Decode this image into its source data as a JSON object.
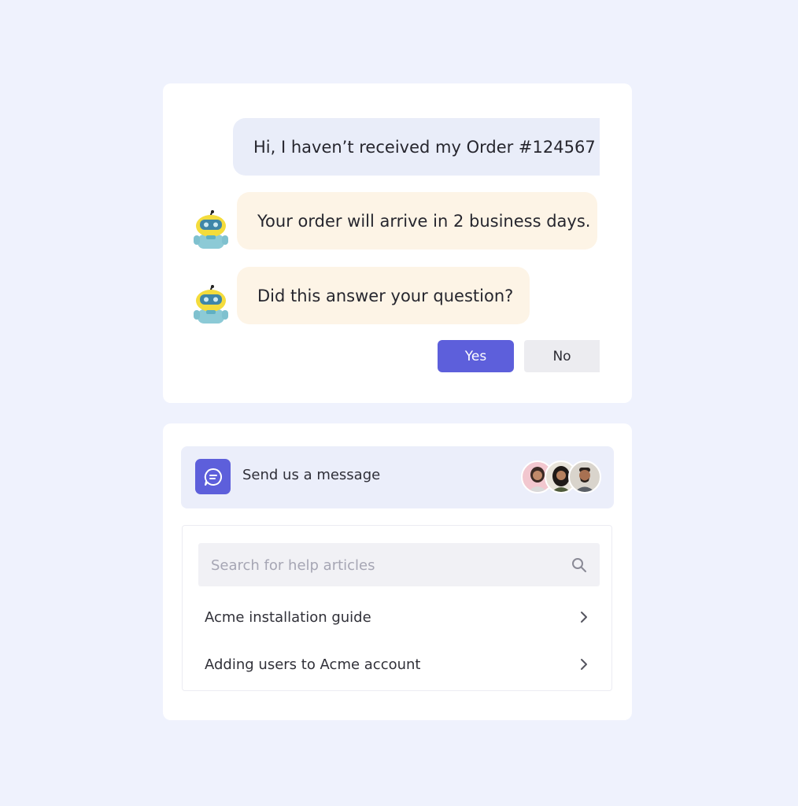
{
  "chat": {
    "messages": [
      {
        "sender": "user",
        "text": "Hi, I haven’t received my Order #124567"
      },
      {
        "sender": "bot",
        "text": "Your order will arrive in 2 business days."
      },
      {
        "sender": "bot",
        "text": "Did this answer your question?"
      }
    ],
    "yes_label": "Yes",
    "no_label": "No"
  },
  "help": {
    "send_label": "Send us a message",
    "search_placeholder": "Search for help articles",
    "articles": [
      {
        "label": "Acme installation guide"
      },
      {
        "label": "Adding users to Acme account"
      }
    ]
  },
  "icons": {
    "send": "chat-bubble-icon",
    "search": "search-icon",
    "article": "chevron-right-icon",
    "bot": "robot-avatar-icon"
  },
  "colors": {
    "accent": "#5d5fdb",
    "user_bubble": "#e9edf9",
    "bot_bubble": "#fdf4e6",
    "background": "#eff2fd"
  }
}
